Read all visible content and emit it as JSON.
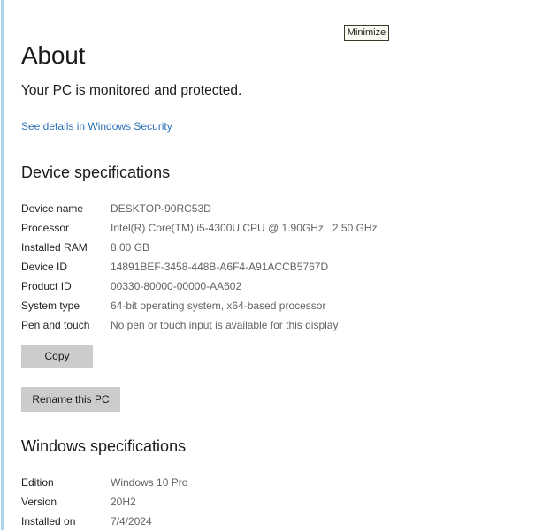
{
  "window": {
    "minimize_label": "Minimize"
  },
  "header": {
    "title": "About",
    "protection_status": "Your PC is monitored and protected.",
    "security_link": "See details in Windows Security"
  },
  "device_specifications": {
    "heading": "Device specifications",
    "rows": [
      {
        "label": "Device name",
        "value": "DESKTOP-90RC53D"
      },
      {
        "label": "Processor",
        "value": "Intel(R) Core(TM) i5-4300U CPU @ 1.90GHz   2.50 GHz"
      },
      {
        "label": "Installed RAM",
        "value": "8.00 GB"
      },
      {
        "label": "Device ID",
        "value": "14891BEF-3458-448B-A6F4-A91ACCB5767D"
      },
      {
        "label": "Product ID",
        "value": "00330-80000-00000-AA602"
      },
      {
        "label": "System type",
        "value": "64-bit operating system, x64-based processor"
      },
      {
        "label": "Pen and touch",
        "value": "No pen or touch input is available for this display"
      }
    ],
    "copy_label": "Copy",
    "rename_label": "Rename this PC"
  },
  "windows_specifications": {
    "heading": "Windows specifications",
    "rows": [
      {
        "label": "Edition",
        "value": "Windows 10 Pro"
      },
      {
        "label": "Version",
        "value": "20H2"
      },
      {
        "label": "Installed on",
        "value": "7/4/2024"
      }
    ]
  },
  "colors": {
    "accent_link": "#2a6fb5",
    "left_edge_strip": "#aed4ec",
    "button_face": "#cccccc",
    "label_text": "#1f1f1f",
    "value_text": "#636363"
  }
}
